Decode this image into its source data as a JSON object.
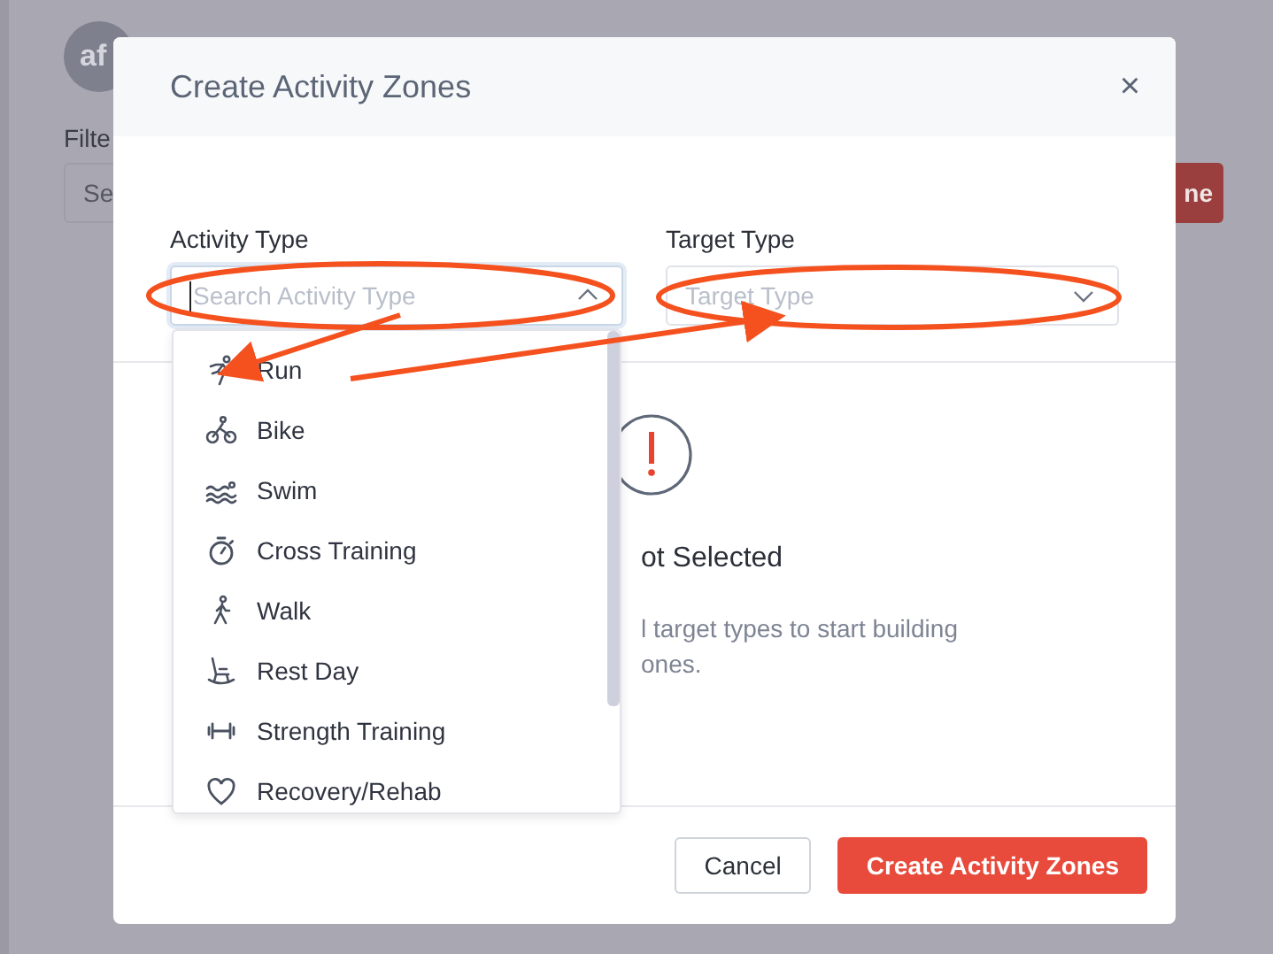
{
  "background": {
    "avatar": "af",
    "filter_label": "Filte",
    "search_placeholder": "Se",
    "button": "ne"
  },
  "modal": {
    "title": "Create Activity Zones",
    "close": "×",
    "fields": [
      {
        "label": "Activity Type",
        "placeholder": "Search Activity Type",
        "open": true
      },
      {
        "label": "Target Type",
        "placeholder": "Target Type",
        "open": false
      }
    ],
    "dropdown": {
      "items": [
        {
          "label": "Run"
        },
        {
          "label": "Bike"
        },
        {
          "label": "Swim"
        },
        {
          "label": "Cross Training"
        },
        {
          "label": "Walk"
        },
        {
          "label": "Rest Day"
        },
        {
          "label": "Strength Training"
        },
        {
          "label": "Recovery/Rehab"
        }
      ]
    },
    "empty_state": {
      "heading": "ot Selected",
      "lines": [
        "l target types to start building",
        "ones."
      ]
    },
    "buttons": [
      {
        "label": "Cancel",
        "kind": "secondary"
      },
      {
        "label": "Create Activity Zones",
        "kind": "primary"
      }
    ]
  }
}
